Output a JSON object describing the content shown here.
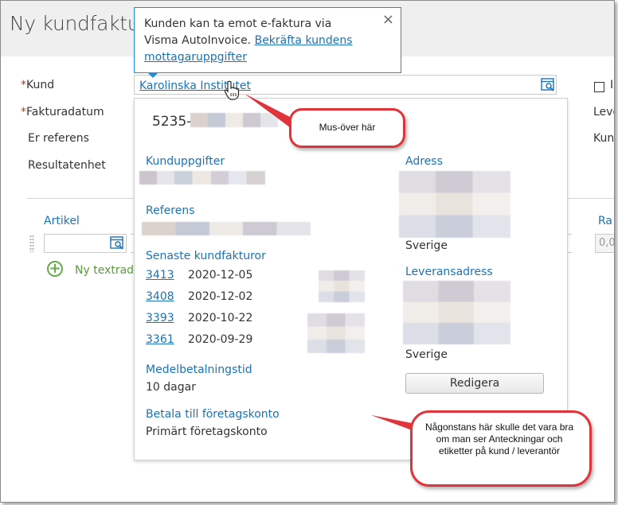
{
  "page": {
    "title": "Ny kundfaktu",
    "fields": {
      "kund_label": "Kund",
      "fakturadatum_label": "Fakturadatum",
      "er_referens_label": "Er referens",
      "resultatenhet_label": "Resultatenhet",
      "required_mark": "*"
    },
    "customer_value": "Karolinska Institutet",
    "right_labels": {
      "checkbox_partial": "I",
      "leve_partial": "Leve",
      "kun_partial": "Kun",
      "ra_partial": "Ra"
    },
    "article_label": "Artikel",
    "new_row_label": "Ny textrad",
    "amount_partial": "0,0"
  },
  "tooltip": {
    "text": "Kunden kan ta emot e-faktura via Visma AutoInvoice.",
    "link": "Bekräfta kundens mottagaruppgifter",
    "close": "×"
  },
  "popup": {
    "customer_number": "5235-",
    "sections": {
      "kunduppgifter": "Kunduppgifter",
      "referens": "Referens",
      "senaste": "Senaste kundfakturor",
      "medelbetalning": "Medelbetalningstid",
      "betala": "Betala till företagskonto",
      "adress": "Adress",
      "leveransadress": "Leveransadress"
    },
    "invoices": [
      {
        "number": "3413",
        "date": "2020-12-05"
      },
      {
        "number": "3408",
        "date": "2020-12-02"
      },
      {
        "number": "3393",
        "date": "2020-10-22"
      },
      {
        "number": "3361",
        "date": "2020-09-29"
      }
    ],
    "medelbetalning_value": "10 dagar",
    "betala_value": "Primärt företagskonto",
    "adress_country": "Sverige",
    "leverans_country": "Sverige",
    "edit_button": "Redigera"
  },
  "annotations": {
    "hover": "Mus-över här",
    "note": "Någonstans här skulle det vara bra om man ser Anteckningar och etiketter på kund / leverantör"
  },
  "colors": {
    "accent": "#1a73b8",
    "annotation": "#e0343a",
    "add": "#6aa84f",
    "required": "#c0392b"
  }
}
